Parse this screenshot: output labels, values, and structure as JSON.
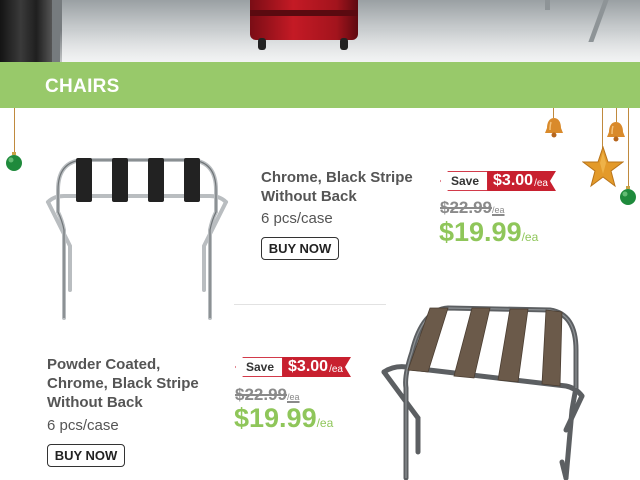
{
  "section": {
    "title": "CHAIRS"
  },
  "products": [
    {
      "name_lines": [
        "Chrome, Black Stripe",
        "Without Back"
      ],
      "pack": "6 pcs/case",
      "button": "BUY NOW",
      "save_label": "Save",
      "save_amount": "$3.00",
      "save_unit": "/ea",
      "old_price": "$22.99",
      "old_unit": "/ea",
      "new_price": "$19.99",
      "new_unit": "/ea",
      "strap_color": "#222222",
      "frame_color": "#b9bdc0"
    },
    {
      "name_lines": [
        "Powder Coated,",
        "Chrome, Black Stripe",
        "Without Back"
      ],
      "pack": "6 pcs/case",
      "button": "BUY NOW",
      "save_label": "Save",
      "save_amount": "$3.00",
      "save_unit": "/ea",
      "old_price": "$22.99",
      "old_unit": "/ea",
      "new_price": "$19.99",
      "new_unit": "/ea",
      "strap_color": "#6b5a4a",
      "frame_color": "#5c5f62"
    }
  ],
  "colors": {
    "banner": "#98c96a",
    "price": "#8fc65a",
    "save": "#c8202f"
  },
  "decor": [
    "green-ornament-icon",
    "gold-bell-icon",
    "gold-star-icon"
  ]
}
